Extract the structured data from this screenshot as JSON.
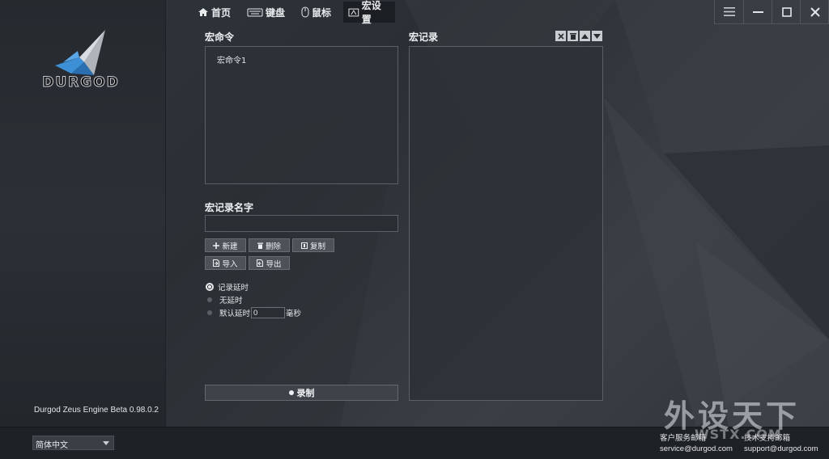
{
  "nav": {
    "tabs": [
      {
        "label": "首页",
        "icon": "home-icon"
      },
      {
        "label": "键盘",
        "icon": "keyboard-icon"
      },
      {
        "label": "鼠标",
        "icon": "mouse-icon"
      },
      {
        "label": "宏设置",
        "icon": "macro-icon"
      }
    ],
    "active_tab": "宏设置"
  },
  "window_controls": [
    "menu-icon",
    "minimize-icon",
    "maximize-icon",
    "close-icon"
  ],
  "brand": {
    "logo_text": "DURGOD",
    "version": "Durgod Zeus Engine Beta 0.98.0.2"
  },
  "macro_commands": {
    "title": "宏命令",
    "items": [
      "宏命令1"
    ]
  },
  "macro_record": {
    "title": "宏记录",
    "tools": [
      "close-icon",
      "trash-icon",
      "arrow-up-icon",
      "arrow-down-icon"
    ]
  },
  "macro_name": {
    "title": "宏记录名字",
    "value": ""
  },
  "buttons": {
    "new": "新建",
    "delete": "删除",
    "copy": "复制",
    "import": "导入",
    "export": "导出"
  },
  "delay_options": {
    "record_delay": "记录延时",
    "no_delay": "无延时",
    "default_delay": "默认延时",
    "default_delay_value": "0",
    "unit": "毫秒",
    "selected": "记录延时"
  },
  "record_button": "录制",
  "footer": {
    "language": "简体中文",
    "customer_service_label": "客户服务邮箱",
    "customer_service_email": "service@durgod.com",
    "tech_support_label": "技术支持邮箱",
    "tech_support_email": "support@durgod.com"
  },
  "watermark": {
    "text": "外设天下",
    "domain": "WSTX.COM"
  },
  "colors": {
    "background": "#2b3036",
    "panel": "#2d3137",
    "active_tab": "#1b1e22",
    "accent_blue": "#3d8fd6"
  }
}
